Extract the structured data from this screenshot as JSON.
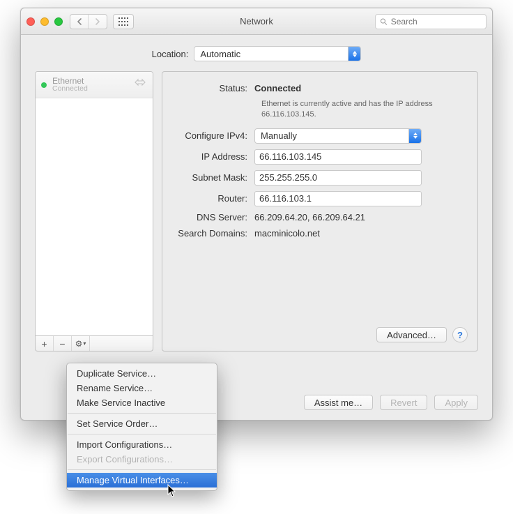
{
  "titlebar": {
    "title": "Network",
    "search_placeholder": "Search"
  },
  "location": {
    "label": "Location:",
    "value": "Automatic"
  },
  "sidebar": {
    "items": [
      {
        "name": "Ethernet",
        "status": "Connected",
        "icon_name": "ethernet-icon"
      }
    ],
    "add_label": "+",
    "remove_label": "−",
    "gear_label": "⚙"
  },
  "details": {
    "status_label": "Status:",
    "status_value": "Connected",
    "status_note": "Ethernet is currently active and has the IP address 66.116.103.145.",
    "configure_label": "Configure IPv4:",
    "configure_value": "Manually",
    "ip_label": "IP Address:",
    "ip_value": "66.116.103.145",
    "subnet_label": "Subnet Mask:",
    "subnet_value": "255.255.255.0",
    "router_label": "Router:",
    "router_value": "66.116.103.1",
    "dns_label": "DNS Server:",
    "dns_value": "66.209.64.20, 66.209.64.21",
    "search_label": "Search Domains:",
    "search_value": "macminicolo.net",
    "advanced_label": "Advanced…",
    "help_label": "?"
  },
  "footer": {
    "assist": "Assist me…",
    "revert": "Revert",
    "apply": "Apply"
  },
  "gear_menu": {
    "items": [
      {
        "label": "Duplicate Service…",
        "enabled": true
      },
      {
        "label": "Rename Service…",
        "enabled": true
      },
      {
        "label": "Make Service Inactive",
        "enabled": true
      },
      {
        "sep": true
      },
      {
        "label": "Set Service Order…",
        "enabled": true
      },
      {
        "sep": true
      },
      {
        "label": "Import Configurations…",
        "enabled": true
      },
      {
        "label": "Export Configurations…",
        "enabled": false
      },
      {
        "sep": true
      },
      {
        "label": "Manage Virtual Interfaces…",
        "enabled": true,
        "selected": true
      }
    ]
  }
}
